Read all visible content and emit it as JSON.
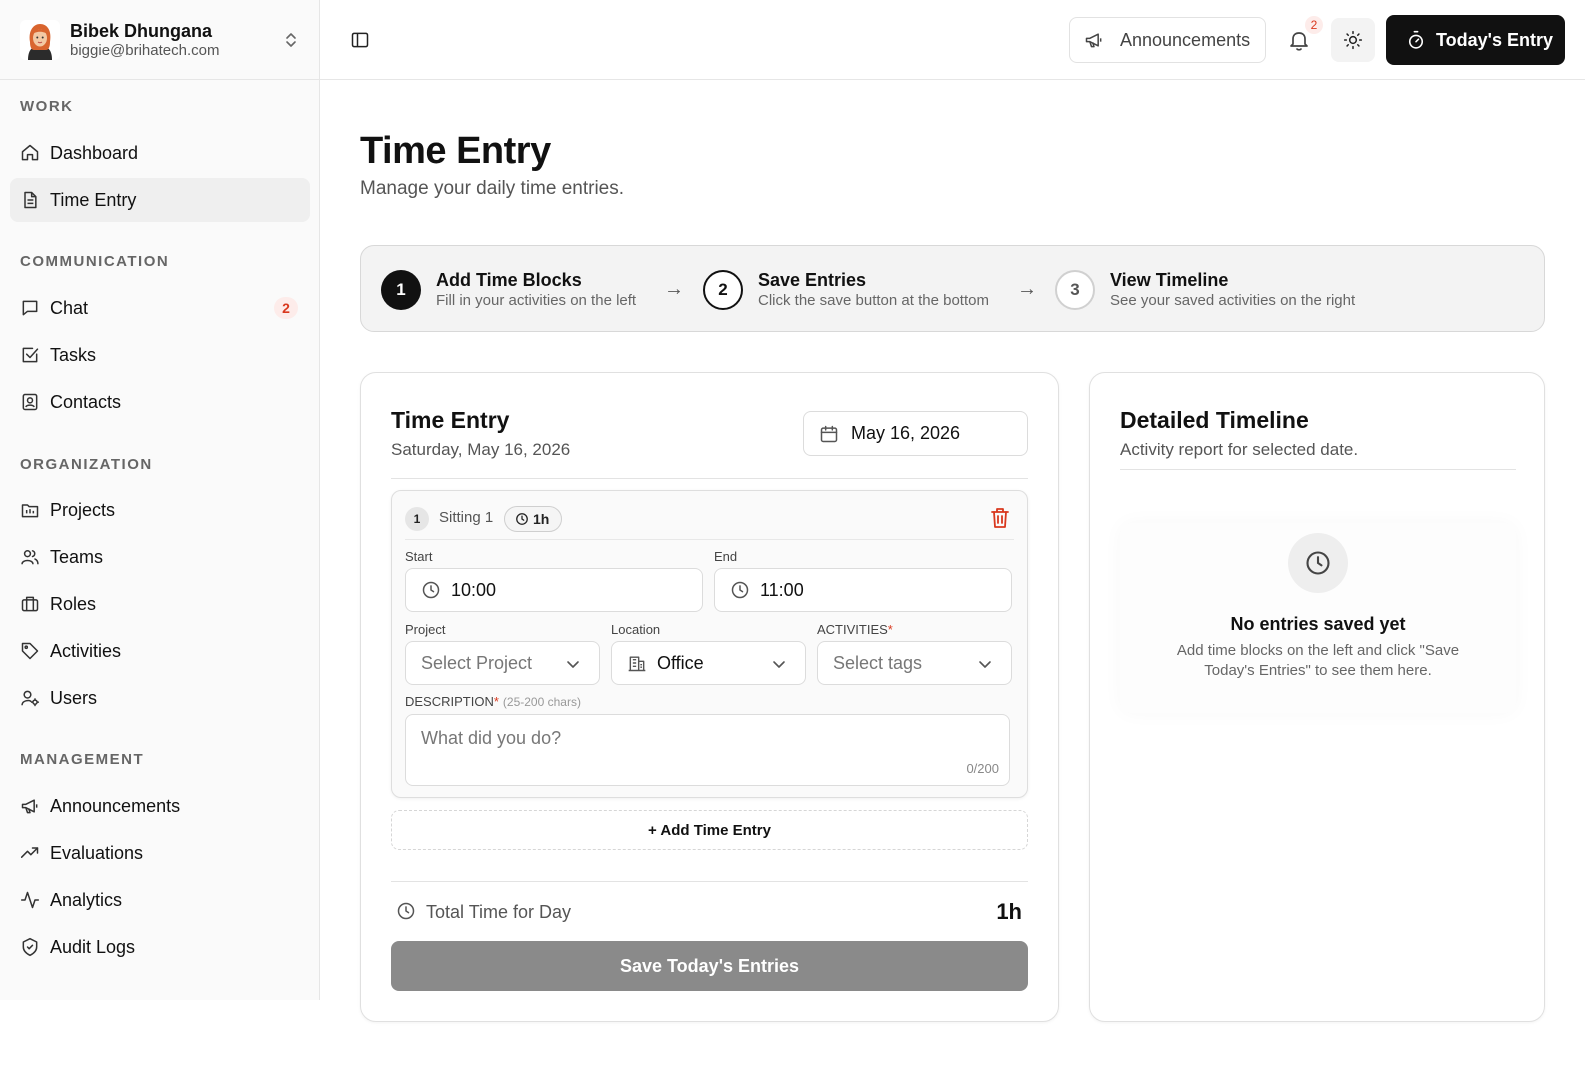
{
  "user": {
    "name": "Bibek Dhungana",
    "email": "biggie@brihatech.com"
  },
  "sidebar": {
    "sections": [
      {
        "title": "WORK",
        "items": [
          {
            "label": "Dashboard",
            "icon": "home-icon"
          },
          {
            "label": "Time Entry",
            "icon": "document-icon",
            "active": true
          }
        ]
      },
      {
        "title": "COMMUNICATION",
        "items": [
          {
            "label": "Chat",
            "icon": "chat-icon",
            "badge": "2"
          },
          {
            "label": "Tasks",
            "icon": "task-check-icon"
          },
          {
            "label": "Contacts",
            "icon": "contact-card-icon"
          }
        ]
      },
      {
        "title": "ORGANIZATION",
        "items": [
          {
            "label": "Projects",
            "icon": "projects-icon"
          },
          {
            "label": "Teams",
            "icon": "team-icon"
          },
          {
            "label": "Roles",
            "icon": "briefcase-icon"
          },
          {
            "label": "Activities",
            "icon": "tag-icon"
          },
          {
            "label": "Users",
            "icon": "user-gear-icon"
          }
        ]
      },
      {
        "title": "MANAGEMENT",
        "items": [
          {
            "label": "Announcements",
            "icon": "megaphone-icon"
          },
          {
            "label": "Evaluations",
            "icon": "trending-up-icon"
          },
          {
            "label": "Analytics",
            "icon": "pulse-icon"
          },
          {
            "label": "Audit Logs",
            "icon": "shield-icon"
          }
        ]
      }
    ]
  },
  "header": {
    "announcements_label": "Announcements",
    "notification_count": "2",
    "today_entry_label": "Today's Entry"
  },
  "page": {
    "title": "Time Entry",
    "subtitle": "Manage your daily time entries."
  },
  "steps": [
    {
      "num": "1",
      "title": "Add Time Blocks",
      "desc": "Fill in your activities on the left"
    },
    {
      "num": "2",
      "title": "Save Entries",
      "desc": "Click the save button at the bottom"
    },
    {
      "num": "3",
      "title": "View Timeline",
      "desc": "See your saved activities on the right"
    }
  ],
  "arrow_glyph": "→",
  "entry_card": {
    "title": "Time Entry",
    "date_long": "Saturday, May 16, 2026",
    "date_picker": "May 16, 2026",
    "sitting": {
      "num": "1",
      "label": "Sitting 1",
      "duration": "1h",
      "start_label": "Start",
      "start_value": "10:00",
      "end_label": "End",
      "end_value": "11:00",
      "project_label": "Project",
      "project_placeholder": "Select Project",
      "location_label": "Location",
      "location_value": "Office",
      "activities_label": "ACTIVITIES",
      "activities_placeholder": "Select tags",
      "description_label": "DESCRIPTION",
      "description_hint": "(25-200 chars)",
      "description_placeholder": "What did you do?",
      "char_count": "0/200",
      "required_mark": "*"
    },
    "add_entry_label": "+ Add Time Entry",
    "total_label": "Total Time for Day",
    "total_value": "1h",
    "save_label": "Save Today's Entries"
  },
  "timeline_card": {
    "title": "Detailed Timeline",
    "subtitle": "Activity report for selected date.",
    "empty_title": "No entries saved yet",
    "empty_desc": "Add time blocks on the left and click \"Save Today's Entries\" to see them here."
  },
  "colors": {
    "accent": "#111111",
    "danger": "#d9381e",
    "disabled_button": "#8a8a8a",
    "sidebar_bg": "#fafafa"
  }
}
